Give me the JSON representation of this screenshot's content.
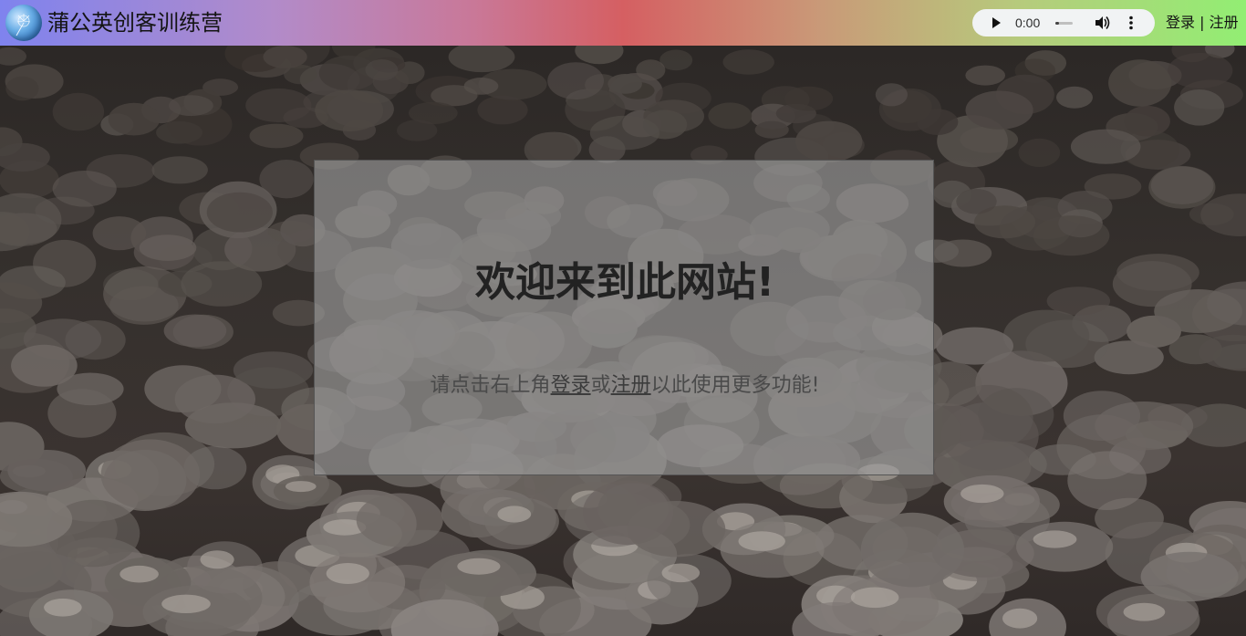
{
  "header": {
    "title": "蒲公英创客训练营",
    "logo_icon": "dandelion-logo-icon"
  },
  "audio_player": {
    "time": "0:00",
    "play_icon": "play-icon",
    "volume_icon": "volume-icon",
    "menu_icon": "more-vert-icon",
    "progress": 0
  },
  "auth": {
    "login": "登录",
    "separator": " | ",
    "register": "注册"
  },
  "welcome": {
    "heading": "欢迎来到此网站!",
    "message_before": "请点击右上角",
    "login_link": "登录",
    "message_or": "或",
    "register_link": "注册",
    "message_after": "以此使用更多功能!"
  },
  "colors": {
    "header_gradient_start": "#7f83ee",
    "header_gradient_mid": "#d55f62",
    "header_gradient_end": "#92ee73",
    "panel_overlay": "#a0a0a0"
  }
}
